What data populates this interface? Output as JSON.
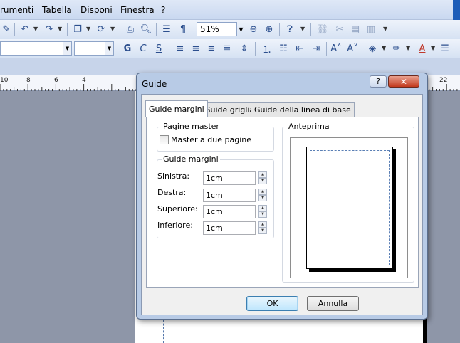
{
  "menu": {
    "items": [
      {
        "pre": "",
        "key": "",
        "rest": "rumenti"
      },
      {
        "pre": "",
        "key": "T",
        "rest": "abella"
      },
      {
        "pre": "",
        "key": "D",
        "rest": "isponi"
      },
      {
        "pre": "Fi",
        "key": "n",
        "rest": "estra"
      },
      {
        "pre": "",
        "key": "?",
        "rest": ""
      }
    ]
  },
  "toolbar": {
    "zoom_value": "51%"
  },
  "ruler": {
    "numbers": [
      "10",
      "8",
      "6",
      "4",
      "22"
    ]
  },
  "dialog": {
    "title": "Guide",
    "help_label": "?",
    "close_label": "X",
    "tabs": [
      {
        "label": "Guide margini",
        "active": true
      },
      {
        "label": "Guide griglia",
        "active": false
      },
      {
        "label": "Guide della linea di base",
        "active": false
      }
    ],
    "master_group": {
      "title": "Pagine master",
      "checkbox_label": "Master a due pagine",
      "checked": false
    },
    "margins_group": {
      "title": "Guide margini",
      "fields": [
        {
          "label": "Sinistra:",
          "value": "1cm"
        },
        {
          "label": "Destra:",
          "value": "1cm"
        },
        {
          "label": "Superiore:",
          "value": "1cm"
        },
        {
          "label": "Inferiore:",
          "value": "1cm"
        }
      ]
    },
    "preview_group": {
      "title": "Anteprima"
    },
    "ok_label": "OK",
    "cancel_label": "Annulla"
  }
}
